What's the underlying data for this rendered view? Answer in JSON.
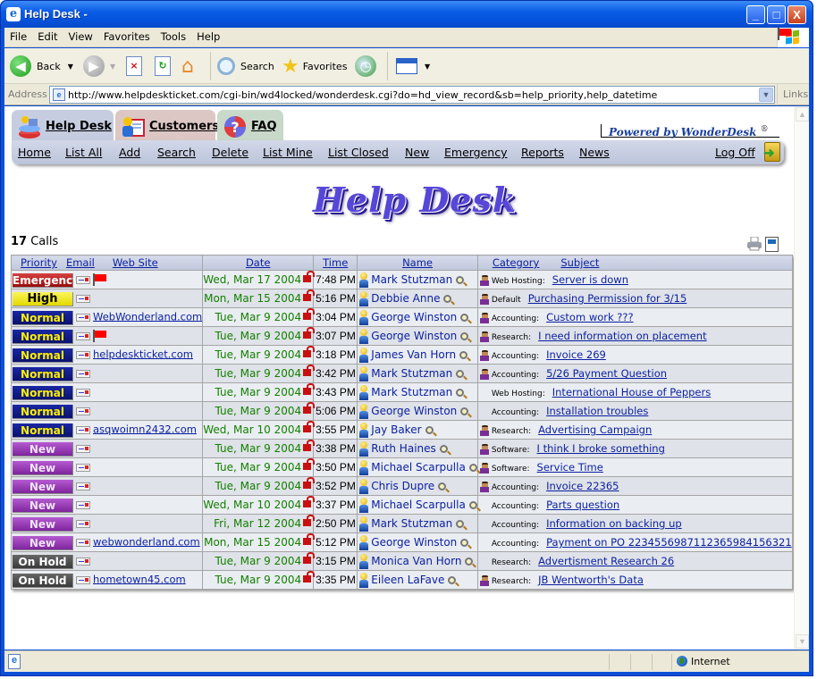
{
  "window": {
    "title": "Help Desk -",
    "minimize": "_",
    "maximize": "□",
    "close": "X"
  },
  "menu": [
    "File",
    "Edit",
    "View",
    "Favorites",
    "Tools",
    "Help"
  ],
  "toolbar": {
    "back": "Back",
    "search": "Search",
    "favorites": "Favorites"
  },
  "address": {
    "label": "Address",
    "url": "http://www.helpdeskticket.com/cgi-bin/wd4locked/wonderdesk.cgi?do=hd_view_record&sb=help_priority,help_datetime",
    "links": "Links"
  },
  "app": {
    "tabs": [
      {
        "label": "Help Desk",
        "icon": "helpdesk-icon"
      },
      {
        "label": "Customers",
        "icon": "customers-icon"
      },
      {
        "label": "FAQ",
        "icon": "faq-icon"
      }
    ],
    "powered_by": "Powered by WonderDesk",
    "registered": "®",
    "nav": [
      "Home",
      "List All",
      "Add",
      "Search",
      "Delete",
      "List Mine",
      "List Closed",
      "New",
      "Emergency",
      "Reports",
      "News"
    ],
    "logoff": "Log Off",
    "logo": "Help  Desk",
    "calls_count": "17",
    "calls_label": "Calls",
    "columns": {
      "priority": "Priority",
      "email": "Email",
      "website": "Web Site",
      "date": "Date",
      "time": "Time",
      "name": "Name",
      "category": "Category",
      "subject": "Subject"
    },
    "colors": {
      "emergency": "#b51d1d",
      "high": "#f2e82a",
      "normal": "#141c8a",
      "new": "#9a3db8",
      "onhold": "#4d4d4d",
      "date_text": "#138000",
      "link": "#0a1fa0"
    },
    "rows": [
      {
        "priority": "Emergency",
        "cls": "p-emergency",
        "flag": true,
        "site": "",
        "date": "Wed, Mar 17 2004",
        "time": "7:48 PM",
        "name": "Mark Stutzman",
        "agent": true,
        "category": "Web Hosting:",
        "subject": "Server is down"
      },
      {
        "priority": "High",
        "cls": "p-high",
        "flag": false,
        "site": "",
        "date": "Mon, Mar 15 2004",
        "time": "5:16 PM",
        "name": "Debbie Anne",
        "agent": true,
        "category": "Default",
        "subject": "Purchasing Permission for 3/15"
      },
      {
        "priority": "Normal",
        "cls": "p-normal",
        "flag": false,
        "site": "WebWonderland.com",
        "date": "Tue, Mar 9 2004",
        "time": "3:04 PM",
        "name": "George Winston",
        "agent": true,
        "category": "Accounting:",
        "subject": "Custom work ???"
      },
      {
        "priority": "Normal",
        "cls": "p-normal",
        "flag": true,
        "site": "",
        "date": "Tue, Mar 9 2004",
        "time": "3:07 PM",
        "name": "George Winston",
        "agent": true,
        "category": "Research:",
        "subject": "I need information on placement"
      },
      {
        "priority": "Normal",
        "cls": "p-normal",
        "flag": false,
        "site": "helpdeskticket.com",
        "date": "Tue, Mar 9 2004",
        "time": "3:18 PM",
        "name": "James Van Horn",
        "agent": true,
        "category": "Accounting:",
        "subject": "Invoice 269"
      },
      {
        "priority": "Normal",
        "cls": "p-normal",
        "flag": false,
        "site": "",
        "date": "Tue, Mar 9 2004",
        "time": "3:42 PM",
        "name": "Mark Stutzman",
        "agent": true,
        "category": "Accounting:",
        "subject": "5/26 Payment Question"
      },
      {
        "priority": "Normal",
        "cls": "p-normal",
        "flag": false,
        "site": "",
        "date": "Tue, Mar 9 2004",
        "time": "3:43 PM",
        "name": "Mark Stutzman",
        "agent": false,
        "category": "Web Hosting:",
        "subject": "International House of Peppers"
      },
      {
        "priority": "Normal",
        "cls": "p-normal",
        "flag": false,
        "site": "",
        "date": "Tue, Mar 9 2004",
        "time": "5:06 PM",
        "name": "George Winston",
        "agent": false,
        "category": "Accounting:",
        "subject": "Installation troubles"
      },
      {
        "priority": "Normal",
        "cls": "p-normal",
        "flag": false,
        "site": "asqwoimn2432.com",
        "date": "Wed, Mar 10 2004",
        "time": "3:55 PM",
        "name": "Jay Baker",
        "agent": true,
        "category": "Research:",
        "subject": "Advertising Campaign"
      },
      {
        "priority": "New",
        "cls": "p-new",
        "flag": false,
        "site": "",
        "date": "Tue, Mar 9 2004",
        "time": "3:38 PM",
        "name": "Ruth Haines",
        "agent": true,
        "category": "Software:",
        "subject": "I think I broke something"
      },
      {
        "priority": "New",
        "cls": "p-new",
        "flag": false,
        "site": "",
        "date": "Tue, Mar 9 2004",
        "time": "3:50 PM",
        "name": "Michael Scarpulla",
        "agent": true,
        "category": "Software:",
        "subject": "Service Time"
      },
      {
        "priority": "New",
        "cls": "p-new",
        "flag": false,
        "site": "",
        "date": "Tue, Mar 9 2004",
        "time": "3:52 PM",
        "name": "Chris Dupre",
        "agent": true,
        "category": "Accounting:",
        "subject": "Invoice 22365"
      },
      {
        "priority": "New",
        "cls": "p-new",
        "flag": false,
        "site": "",
        "date": "Wed, Mar 10 2004",
        "time": "3:37 PM",
        "name": "Michael Scarpulla",
        "agent": false,
        "category": "Accounting:",
        "subject": "Parts question"
      },
      {
        "priority": "New",
        "cls": "p-new",
        "flag": false,
        "site": "",
        "date": "Fri, Mar 12 2004",
        "time": "2:50 PM",
        "name": "Mark Stutzman",
        "agent": false,
        "category": "Accounting:",
        "subject": "Information on backing up"
      },
      {
        "priority": "New",
        "cls": "p-new",
        "flag": false,
        "site": "webwonderland.com",
        "date": "Mon, Mar 15 2004",
        "time": "5:12 PM",
        "name": "George Winston",
        "agent": false,
        "category": "Accounting:",
        "subject": "Payment on PO 22345569871123659841563 21"
      },
      {
        "priority": "On Hold",
        "cls": "p-onhold",
        "flag": false,
        "site": "",
        "date": "Tue, Mar 9 2004",
        "time": "3:15 PM",
        "name": "Monica Van Horn",
        "agent": false,
        "category": "Research:",
        "subject": "Advertisment Research 26"
      },
      {
        "priority": "On Hold",
        "cls": "p-onhold",
        "flag": false,
        "site": "hometown45.com",
        "date": "Tue, Mar 9 2004",
        "time": "3:35 PM",
        "name": "Eileen LaFave",
        "agent": true,
        "category": "Research:",
        "subject": "JB Wentworth's Data"
      }
    ]
  },
  "status": {
    "zone": "Internet"
  }
}
